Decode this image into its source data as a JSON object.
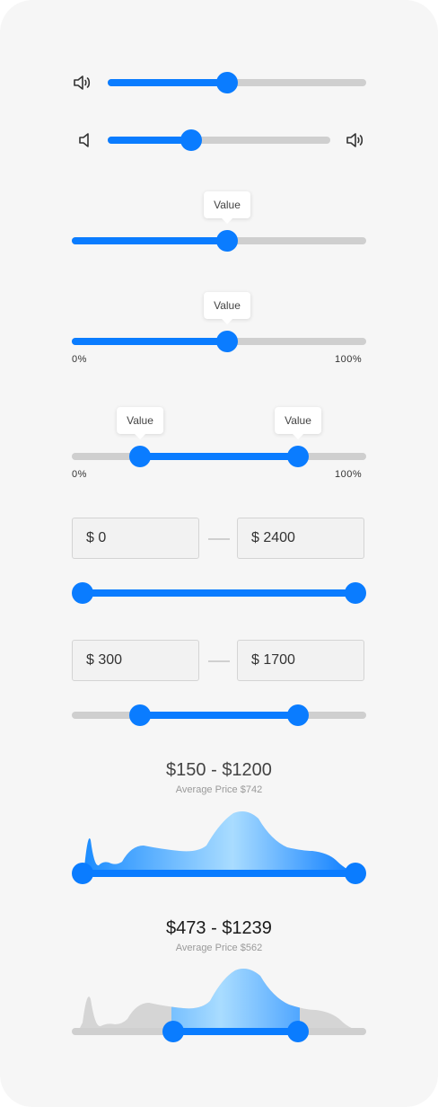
{
  "colors": {
    "accent": "#0a7cff",
    "track": "#cfcfcf",
    "background": "#f6f6f6"
  },
  "volume_slider": {
    "icon": "speaker-volume-icon",
    "value_fraction": 0.53
  },
  "volume_slider_2": {
    "left_icon": "speaker-mute-icon",
    "right_icon": "speaker-volume-icon",
    "value_fraction": 0.38
  },
  "tooltip_slider": {
    "tooltip": "Value",
    "value_fraction": 0.53
  },
  "tooltip_slider_labeled": {
    "tooltip": "Value",
    "min_label": "0%",
    "max_label": "100%",
    "value_fraction": 0.53
  },
  "range_tooltip_slider": {
    "low_tooltip": "Value",
    "high_tooltip": "Value",
    "min_label": "0%",
    "max_label": "100%",
    "low_fraction": 0.23,
    "high_fraction": 0.77
  },
  "price_range_1": {
    "min_value": "$ 0",
    "max_value": "$ 2400",
    "low_fraction": 0.0,
    "high_fraction": 1.0
  },
  "price_range_2": {
    "min_value": "$ 300",
    "max_value": "$ 1700",
    "low_fraction": 0.23,
    "high_fraction": 0.77
  },
  "histogram_1": {
    "range": "$150 - $1200",
    "average": "Average Price $742",
    "low_fraction": 0.0,
    "high_fraction": 1.0
  },
  "histogram_2": {
    "range": "$473 - $1239",
    "average": "Average Price $562",
    "low_fraction": 0.345,
    "high_fraction": 0.77
  }
}
